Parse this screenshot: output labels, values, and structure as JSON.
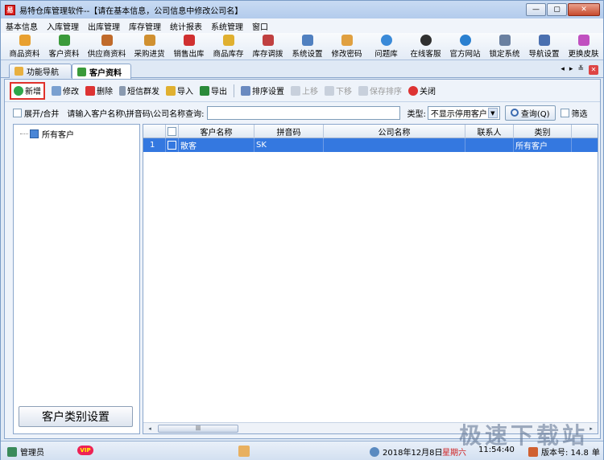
{
  "window": {
    "title": "易特仓库管理软件--【请在基本信息，公司信息中修改公司名】",
    "app_icon": "易"
  },
  "menu": [
    "基本信息",
    "入库管理",
    "出库管理",
    "库存管理",
    "统计报表",
    "系统管理",
    "窗口"
  ],
  "toolbar": [
    {
      "label": "商品资料",
      "color": "#e8a030"
    },
    {
      "label": "客户资料",
      "color": "#3a9a3a"
    },
    {
      "label": "供应商资料",
      "color": "#c06a2a"
    },
    {
      "label": "采购进货",
      "color": "#d09030"
    },
    {
      "label": "销售出库",
      "color": "#d03030"
    },
    {
      "label": "商品库存",
      "color": "#e0b030"
    },
    {
      "label": "库存调拨",
      "color": "#c04040"
    },
    {
      "label": "系统设置",
      "color": "#5080c0"
    },
    {
      "label": "修改密码",
      "color": "#e0a040"
    },
    {
      "label": "问题库",
      "color": "#3a8ad8"
    },
    {
      "label": "在线客服",
      "color": "#303030"
    },
    {
      "label": "官方网站",
      "color": "#2a80d0"
    },
    {
      "label": "锁定系统",
      "color": "#6a80a0"
    },
    {
      "label": "导航设置",
      "color": "#4a70b0"
    },
    {
      "label": "更换皮肤",
      "color": "#c050c0"
    }
  ],
  "tabs": [
    {
      "label": "功能导航",
      "active": false
    },
    {
      "label": "客户资料",
      "active": true
    }
  ],
  "actions": {
    "new": "新增",
    "edit": "修改",
    "delete": "删除",
    "sms": "短信群发",
    "import": "导入",
    "export": "导出",
    "sort_setting": "排序设置",
    "move_up": "上移",
    "move_down": "下移",
    "save_sort": "保存排序",
    "close": "关闭"
  },
  "search": {
    "expand_merge": "展开/合并",
    "prompt": "请输入客户名称\\拼音码\\公司名称查询:",
    "value": "",
    "type_label": "类型:",
    "type_value": "不显示停用客户",
    "query_btn": "查询(Q)",
    "filter": "筛选"
  },
  "tree": {
    "root": "所有客户"
  },
  "category_btn": "客户类别设置",
  "grid": {
    "columns": [
      "客户名称",
      "拼音码",
      "公司名称",
      "联系人",
      "类别"
    ],
    "rows": [
      {
        "num": "1",
        "name": "散客",
        "pinyin": "SK",
        "company": "",
        "contact": "",
        "category": "所有客户"
      }
    ]
  },
  "status": {
    "user": "管理员",
    "vip": "VIP",
    "date": "2018年12月8日",
    "weekday": "星期六",
    "time": "11:54:40",
    "version": "版本号: 14.8",
    "unit": "单"
  },
  "watermark": "极速下载站"
}
